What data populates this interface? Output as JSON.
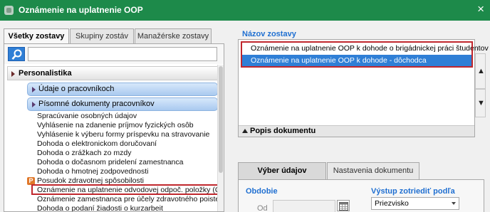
{
  "window": {
    "title": "Oznámenie na uplatnenie OOP",
    "close_glyph": "×"
  },
  "left_tabs": [
    {
      "label": "Všetky zostavy",
      "active": true
    },
    {
      "label": "Skupiny zostáv",
      "active": false
    },
    {
      "label": "Manažérske zostavy",
      "active": false
    }
  ],
  "search": {
    "value": "",
    "placeholder": ""
  },
  "tree": {
    "main_group": "Personalistika",
    "sub_groups": [
      "Údaje o pracovníkoch",
      "Písomné dokumenty pracovníkov"
    ],
    "items": [
      "Spracúvanie osobných údajov",
      "Vyhlásenie na zdanenie príjmov fyzických osôb",
      "Vyhlásenie k výberu formy príspevku na stravovanie",
      "Dohoda o elektronickom doručovaní",
      "Dohoda o zrážkach zo mzdy",
      "Dohoda o dočasnom pridelení zamestnanca",
      "Dohoda o hmotnej zodpovednosti",
      "Posudok zdravotnej spôsobilosti",
      "Oznámenie na uplatnenie odvodovej odpoč. položky (OOP",
      "Oznámenie zamestnanca pre účely zdravotného poistenia",
      "Dohoda o podaní žiadosti o kurzarbeit"
    ],
    "badge_letter": "P"
  },
  "right": {
    "list_title": "Názov zostavy",
    "list_items": [
      "Oznámenie na uplatnenie OOP k dohode o brigádnickej práci študentov",
      "Oznámenie na uplatnenie OOP k dohode - dôchodca"
    ],
    "footer_label": "Popis dokumentu",
    "up_arrow": "▲",
    "down_arrow": "▼",
    "tabs": [
      "Výber údajov",
      "Nastavenia dokumentu"
    ],
    "obdobie_label": "Obdobie",
    "od_label": "Od",
    "od_value": "",
    "sort_label": "Výstup zotriediť podľa",
    "sort_value": "Priezvisko"
  },
  "colors": {
    "titlebar": "#1d8a4a",
    "accent_blue": "#1f6fd1",
    "selection": "#2f7fd6",
    "highlight_red": "#c0272d"
  }
}
